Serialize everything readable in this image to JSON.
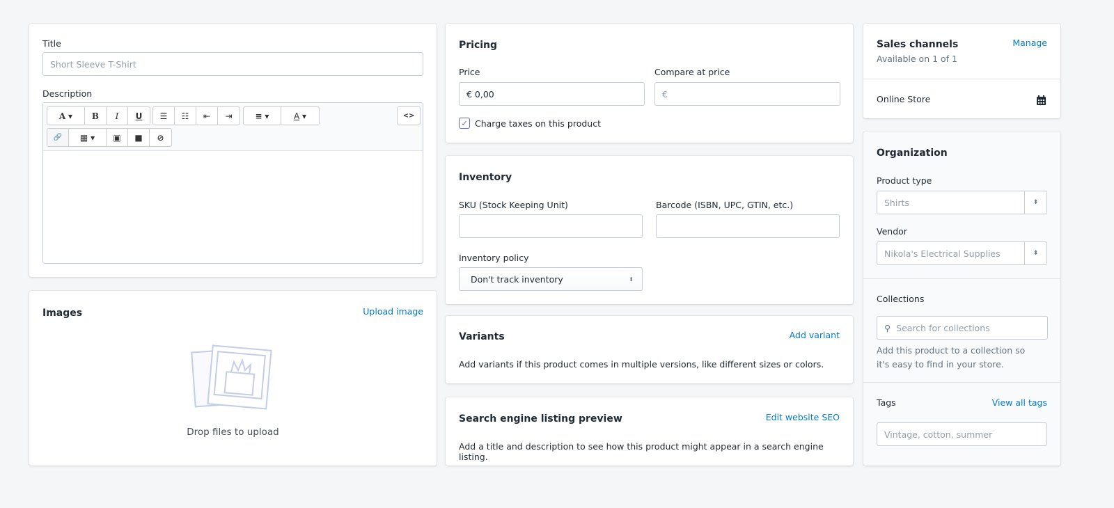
{
  "title_card": {
    "title_label": "Title",
    "title_placeholder": "Short Sleeve T-Shirt",
    "description_label": "Description",
    "toolbar": {
      "font": "A",
      "bold": "B",
      "italic": "I",
      "underline": "U",
      "bullet": "☰",
      "numbered": "☷",
      "outdent": "⇤",
      "indent": "⇥",
      "align": "≡",
      "color": "A",
      "caret": "▾",
      "code": "<>",
      "link": "🔗",
      "table": "▦",
      "image": "▣",
      "video": "■",
      "clear": "⊘"
    }
  },
  "images": {
    "title": "Images",
    "upload_link": "Upload image",
    "drop_text": "Drop files to upload"
  },
  "pricing": {
    "title": "Pricing",
    "price_label": "Price",
    "price_value": "€ 0,00",
    "compare_label": "Compare at price",
    "compare_placeholder": "€",
    "charge_taxes_label": "Charge taxes on this product",
    "charge_taxes_checked": true
  },
  "inventory": {
    "title": "Inventory",
    "sku_label": "SKU (Stock Keeping Unit)",
    "barcode_label": "Barcode (ISBN, UPC, GTIN, etc.)",
    "policy_label": "Inventory policy",
    "policy_value": "Don't track inventory"
  },
  "variants": {
    "title": "Variants",
    "add_link": "Add variant",
    "text": "Add variants if this product comes in multiple versions, like different sizes or colors."
  },
  "seo": {
    "title": "Search engine listing preview",
    "edit_link": "Edit website SEO",
    "text": "Add a title and description to see how this product might appear in a search engine listing."
  },
  "sales_channels": {
    "title": "Sales channels",
    "manage_link": "Manage",
    "subtitle": "Available on 1 of 1",
    "channel": "Online Store",
    "icon": "calendar-icon"
  },
  "organization": {
    "title": "Organization",
    "product_type_label": "Product type",
    "product_type_value": "Shirts",
    "vendor_label": "Vendor",
    "vendor_value": "Nikola's Electrical Supplies",
    "collections_label": "Collections",
    "collections_placeholder": "Search for collections",
    "collections_help": "Add this product to a collection so it's easy to find in your store.",
    "tags_label": "Tags",
    "view_tags_link": "View all tags",
    "tags_placeholder": "Vintage, cotton, summer"
  },
  "colors": {
    "link": "#007ace",
    "background": "#f4f6f8",
    "checkbox": "#5c6ac4"
  }
}
